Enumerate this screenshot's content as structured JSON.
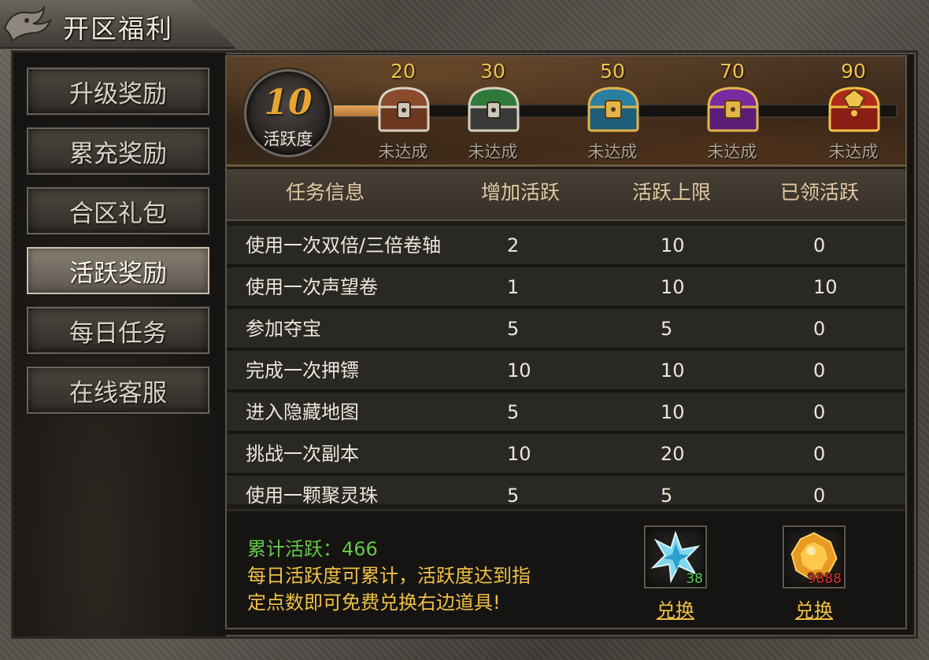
{
  "title": "开区福利",
  "sidebar": {
    "items": [
      {
        "label": "升级奖励",
        "active": false
      },
      {
        "label": "累充奖励",
        "active": false
      },
      {
        "label": "合区礼包",
        "active": false
      },
      {
        "label": "活跃奖励",
        "active": true
      },
      {
        "label": "每日任务",
        "active": false
      },
      {
        "label": "在线客服",
        "active": false
      }
    ]
  },
  "activity": {
    "value": "10",
    "label": "活跃度",
    "progress_value": 10,
    "progress_max": 90
  },
  "chests": [
    {
      "threshold": "20",
      "status": "未达成",
      "color": "#8a4a2c",
      "icon": "bronze-chest-icon"
    },
    {
      "threshold": "30",
      "status": "未达成",
      "color": "#2f7a3a",
      "icon": "green-chest-icon"
    },
    {
      "threshold": "50",
      "status": "未达成",
      "color": "#2a7fa0",
      "icon": "blue-chest-icon"
    },
    {
      "threshold": "70",
      "status": "未达成",
      "color": "#7a2aa0",
      "icon": "purple-chest-icon"
    },
    {
      "threshold": "90",
      "status": "未达成",
      "color": "#b02a1c",
      "icon": "red-chest-icon"
    }
  ],
  "table": {
    "headers": [
      "任务信息",
      "增加活跃",
      "活跃上限",
      "已领活跃"
    ],
    "rows": [
      [
        "使用一次双倍/三倍卷轴",
        "2",
        "10",
        "0"
      ],
      [
        "使用一次声望卷",
        "1",
        "10",
        "10"
      ],
      [
        "参加夺宝",
        "5",
        "5",
        "0"
      ],
      [
        "完成一次押镖",
        "10",
        "10",
        "0"
      ],
      [
        "进入隐藏地图",
        "5",
        "10",
        "0"
      ],
      [
        "挑战一次副本",
        "10",
        "20",
        "0"
      ],
      [
        "使用一颗聚灵珠",
        "5",
        "5",
        "0"
      ]
    ]
  },
  "bottom": {
    "total_label": "累计活跃：466",
    "desc_line1": "每日活跃度可累计，活跃度达到指",
    "desc_line2": "定点数即可免费兑换右边道具!",
    "items": [
      {
        "icon": "blue-crystal-icon",
        "count": "38",
        "count_color": "#5fd35a",
        "exchange": "兑换"
      },
      {
        "icon": "gold-gem-icon",
        "count": "9888",
        "count_color": "#e0332a",
        "exchange": "兑换"
      }
    ]
  }
}
